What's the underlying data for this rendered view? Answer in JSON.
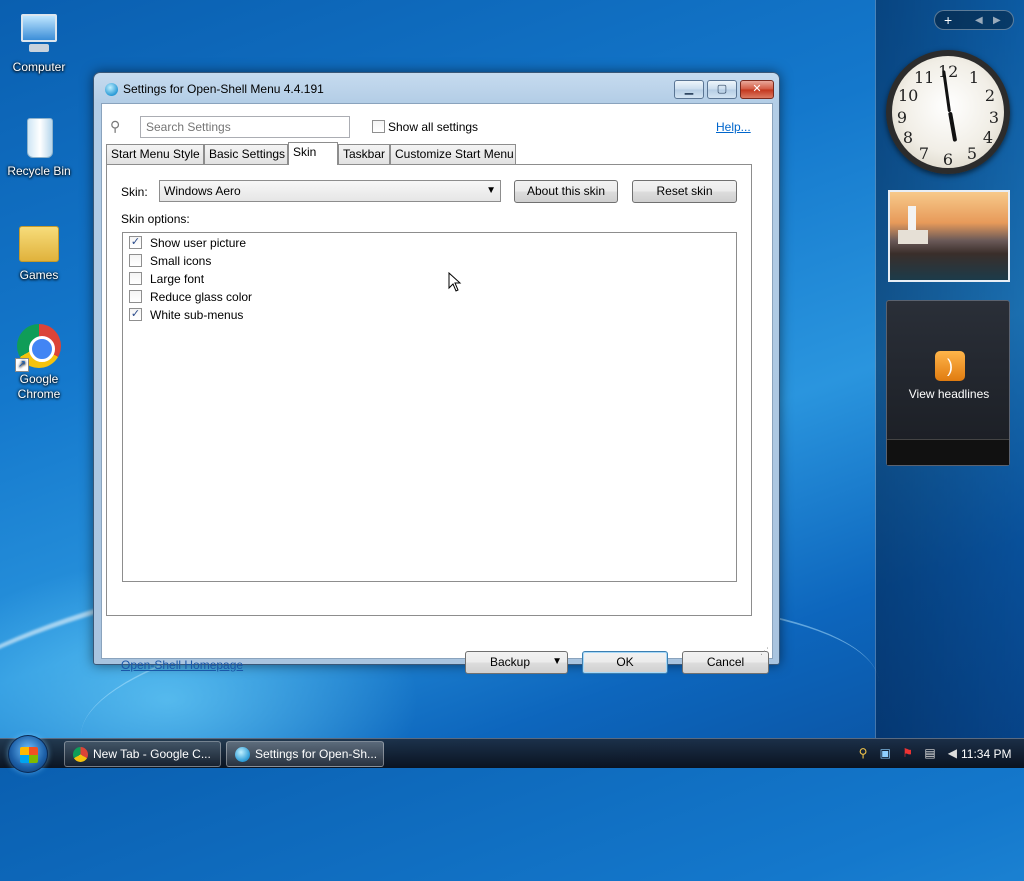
{
  "desktop": {
    "icons": [
      {
        "label": "Computer"
      },
      {
        "label": "Recycle Bin"
      },
      {
        "label": "Games"
      },
      {
        "label_line1": "Google",
        "label_line2": "Chrome"
      }
    ]
  },
  "sidebar": {
    "clock_numbers": [
      "12",
      "1",
      "2",
      "3",
      "4",
      "5",
      "6",
      "7",
      "8",
      "9",
      "10",
      "11"
    ],
    "feed_text": "View headlines",
    "add_glyph": "+"
  },
  "window": {
    "title": "Settings for Open-Shell Menu 4.4.191",
    "search_placeholder": "Search Settings",
    "show_all_label": "Show all settings",
    "help_label": "Help...",
    "tabs": [
      {
        "label": "Start Menu Style"
      },
      {
        "label": "Basic Settings"
      },
      {
        "label": "Skin"
      },
      {
        "label": "Taskbar"
      },
      {
        "label": "Customize Start Menu"
      }
    ],
    "active_tab": "Skin",
    "skin_label": "Skin:",
    "skin_value": "Windows Aero",
    "about_button": "About this skin",
    "reset_button": "Reset skin",
    "skin_options_label": "Skin options:",
    "options": [
      {
        "label": "Show user picture",
        "checked": true
      },
      {
        "label": "Small icons",
        "checked": false
      },
      {
        "label": "Large font",
        "checked": false
      },
      {
        "label": "Reduce glass color",
        "checked": false
      },
      {
        "label": "White sub-menus",
        "checked": true
      }
    ],
    "homepage_link": "Open-Shell Homepage",
    "backup_button": "Backup",
    "ok_button": "OK",
    "cancel_button": "Cancel"
  },
  "taskbar": {
    "tasks": [
      {
        "label": "New Tab - Google C..."
      },
      {
        "label": "Settings for Open-Sh..."
      }
    ],
    "time": "11:34 PM"
  }
}
